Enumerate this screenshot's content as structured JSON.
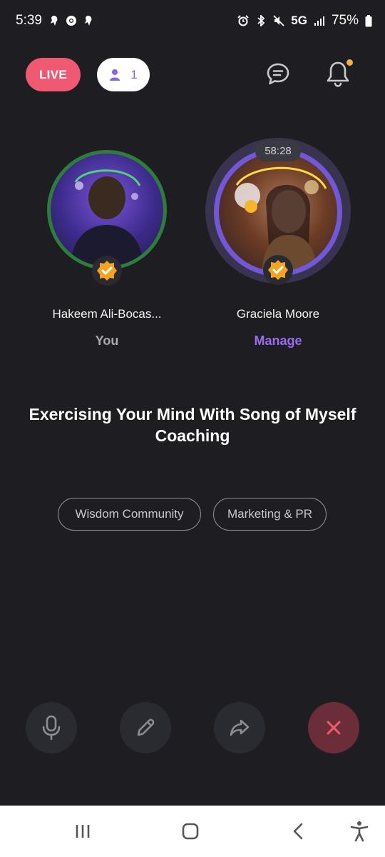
{
  "status_bar": {
    "time": "5:39",
    "network": "5G",
    "battery": "75%",
    "left_icons": [
      "notification-icon",
      "chrome-icon",
      "notification-icon"
    ],
    "right_icons": [
      "alarm-icon",
      "bluetooth-icon",
      "mute-icon",
      "signal-icon",
      "battery-icon"
    ]
  },
  "header": {
    "live_label": "LIVE",
    "listener_count": "1",
    "colors": {
      "live": "#ef5a72",
      "accent": "#8a63e6",
      "notification_dot": "#f3b13f"
    }
  },
  "speakers": [
    {
      "name": "Hakeem Ali-Bocas...",
      "sub_label": "You",
      "sub_color": "#a9a9b1",
      "avatar_icon": "avatar-photo"
    },
    {
      "name": "Graciela Moore",
      "sub_label": "Manage",
      "sub_color": "#9b6cf0",
      "avatar_icon": "avatar-photo",
      "timer": "58:28"
    }
  ],
  "room": {
    "title": "Exercising Your Mind With Song of Myself Coaching",
    "tags": [
      "Wisdom Community",
      "Marketing & PR"
    ]
  },
  "controls": [
    "microphone-icon",
    "pencil-icon",
    "share-icon",
    "close-icon"
  ],
  "nav": [
    "recents-icon",
    "home-icon",
    "back-icon",
    "accessibility-icon"
  ]
}
